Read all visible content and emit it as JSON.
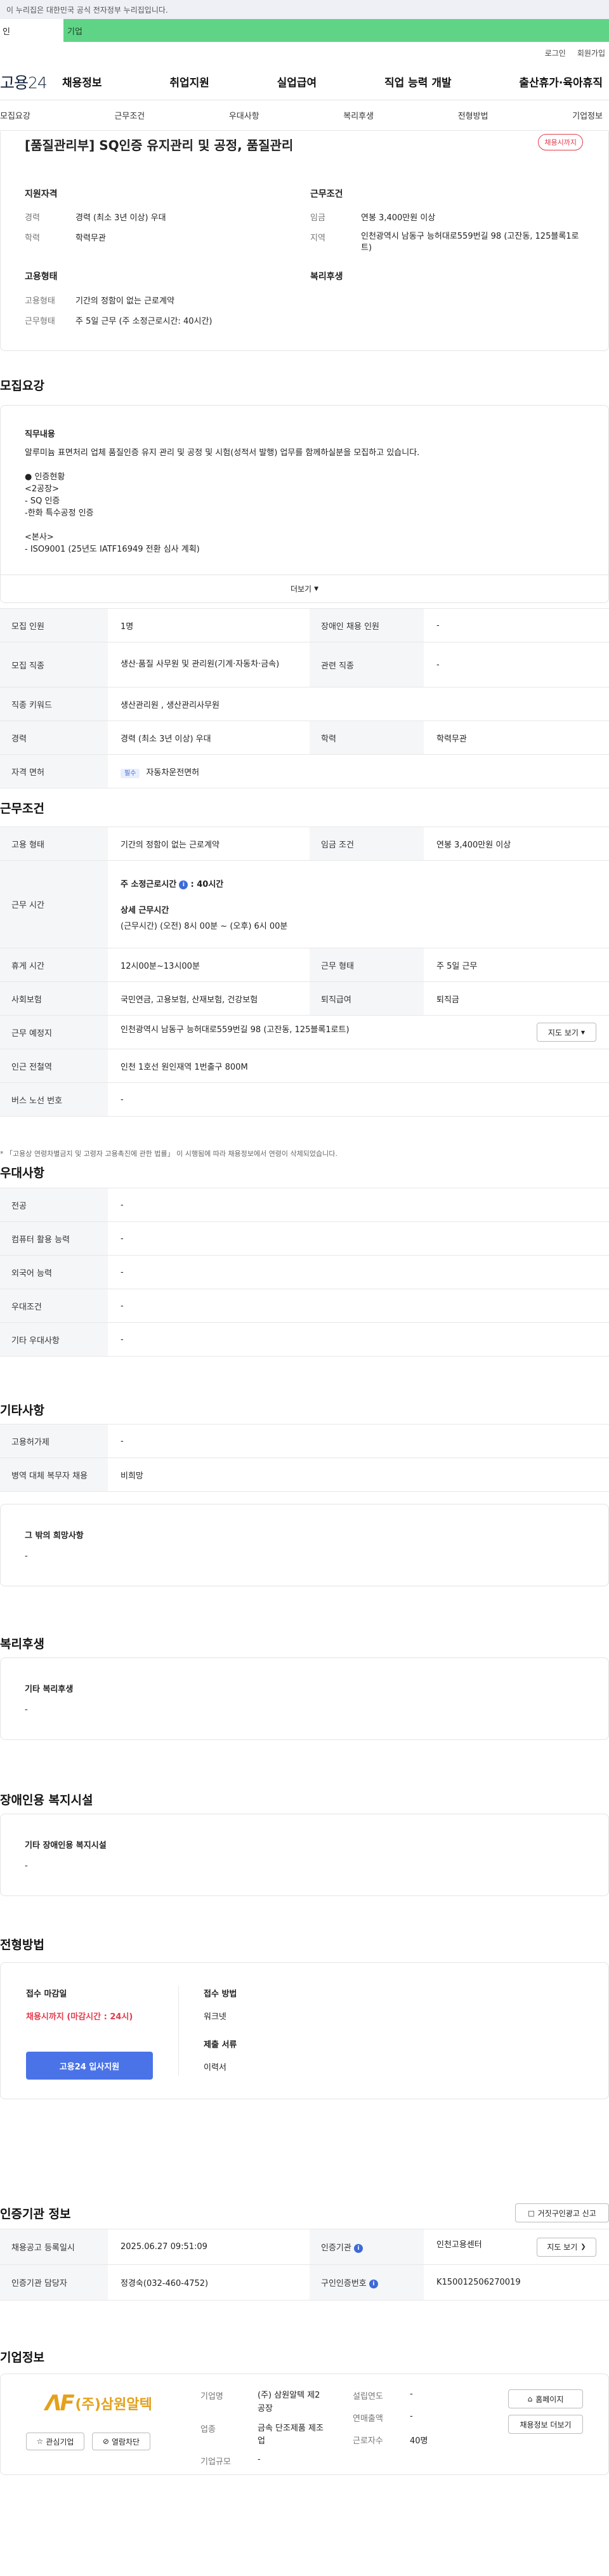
{
  "gov_bar": "이 누리집은 대한민국 공식 전자정부 누리집입니다.",
  "top_tabs": [
    "인",
    "기업"
  ],
  "util": [
    "로그인",
    "회원가입"
  ],
  "logo": "고용24",
  "gnb": [
    "채용정보",
    "취업지원",
    "실업급여",
    "직업 능력 개발",
    "출산휴가·육아휴직"
  ],
  "tabs": [
    "모집요강",
    "근무조건",
    "우대사항",
    "복리후생",
    "전형방법",
    "기업정보"
  ],
  "job": {
    "title": "[품질관리부] SQ인증 유지관리 및 공정, 품질관리",
    "badge": "채용시까지",
    "support_h": "지원자격",
    "cond_h": "근무조건",
    "employ_h": "고용형태",
    "welfare_h": "복리후생",
    "s1_l": "경력",
    "s1_v": "경력 (최소 3년 이상) 우대",
    "s2_l": "학력",
    "s2_v": "학력무관",
    "c1_l": "임금",
    "c1_v": "연봉 3,400만원 이상",
    "c2_l": "지역",
    "c2_v": "인천광역시 남동구 능허대로559번길 98 (고잔동, 125블록1로트)",
    "e1_l": "고용형태",
    "e1_v": "기간의 정함이 없는 근로계약",
    "e2_l": "근무형태",
    "e2_v": "주 5일 근무 (주 소정근로시간: 40시간)"
  },
  "recruit": {
    "title": "모집요강",
    "duty_h": "직무내용",
    "duty_lines": [
      "알루미늄 표면처리 업체 품질인증 유지 관리 및 공정 및 시험(성적서 발행) 업무를 함께하실분을 모집하고 있습니다.",
      "",
      "● 인증현황",
      "<2공장>",
      "- SQ 인증",
      "-한화 특수공정 인증",
      "",
      "<본사>",
      "- ISO9001 (25년도 IATF16949 전환 심사 계획)"
    ],
    "more": "더보기",
    "rows": [
      {
        "l1": "모집 인원",
        "v1": "1명",
        "l2": "장애인 채용 인원",
        "v2": "-"
      },
      {
        "l1": "모집 직종",
        "v1": "생산·품질 사무원 및 관리원(기계·자동차·금속)",
        "l2": "관련 직종",
        "v2": "-"
      },
      {
        "l1": "직종 키워드",
        "v1": "생산관리원 , 생산관리사무원"
      },
      {
        "l1": "경력",
        "v1": "경력 (최소 3년 이상) 우대",
        "l2": "학력",
        "v2": "학력무관"
      },
      {
        "l1": "자격 면허",
        "tag": "필수",
        "v1": "자동차운전면허"
      }
    ]
  },
  "work": {
    "title": "근무조건",
    "r1_l": "고용 형태",
    "r1_v": "기간의 정함이 없는 근로계약",
    "r1_l2": "임금 조건",
    "r1_v2": "연봉 3,400만원 이상",
    "r2_l": "근무 시간",
    "r2_a": "주 소정근로시간",
    "r2_b": ": 40시간",
    "r2_c": "상세 근무시간",
    "r2_d": "(근무시간) (오전) 8시 00분 ~ (오후) 6시 00분",
    "r3_l": "휴게 시간",
    "r3_v": "12시00분~13시00분",
    "r3_l2": "근무 형태",
    "r3_v2": "주 5일 근무",
    "r4_l": "사회보험",
    "r4_v": "국민연금, 고용보험, 산재보험, 건강보험",
    "r4_l2": "퇴직급여",
    "r4_v2": "퇴직금",
    "r5_l": "근무 예정지",
    "r5_v": "인천광역시 남동구 능허대로559번길 98 (고잔동, 125블록1로트)",
    "r5_btn": "지도 보기",
    "r6_l": "인근 전철역",
    "r6_v": "인천 1호선 원인재역 1번출구 800M",
    "r7_l": "버스 노선 번호",
    "r7_v": "-",
    "note": "* 「고용상 연령차별금지 및 고령자 고용촉진에 관한 법률」 이 시행됨에 따라 채용정보에서 연령이 삭제되었습니다."
  },
  "pref": {
    "title": "우대사항",
    "rows": [
      {
        "l": "전공",
        "v": "-"
      },
      {
        "l": "컴퓨터 활용 능력",
        "v": "-"
      },
      {
        "l": "외국어 능력",
        "v": "-"
      },
      {
        "l": "우대조건",
        "v": "-"
      },
      {
        "l": "기타 우대사항",
        "v": "-"
      }
    ]
  },
  "etc": {
    "title": "기타사항",
    "rows": [
      {
        "l": "고용허가제",
        "v": "-"
      },
      {
        "l": "병역 대체 복무자 채용",
        "v": "비희망"
      }
    ],
    "other_h": "그 밖의 희망사항",
    "other_v": "-"
  },
  "welfare": {
    "title": "복리후생",
    "h": "기타 복리후생",
    "v": "-"
  },
  "disab": {
    "title": "장애인용 복지시설",
    "h": "기타 장애인용 복지시설",
    "v": "-"
  },
  "proc": {
    "title": "전형방법",
    "deadline_h": "접수 마감일",
    "deadline_v": "채용시까지 (마감시간 : 24시)",
    "apply_btn": "고용24 입사지원",
    "method_h": "접수 방법",
    "method_v": "워크넷",
    "docs_h": "제출 서류",
    "docs_v": "이력서"
  },
  "agency": {
    "title": "인증기관 정보",
    "report_btn": "거짓구인광고 신고",
    "r1_l": "채용공고 등록일시",
    "r1_v": "2025.06.27 09:51:09",
    "r1_l2": "인증기관",
    "r1_v2": "인천고용센터",
    "r1_btn": "지도 보기",
    "r2_l": "인증기관 담당자",
    "r2_v": "정경숙(032-460-4752)",
    "r2_l2": "구인인증번호",
    "r2_v2": "K150012506270019"
  },
  "company": {
    "title": "기업정보",
    "logo_text": "(주)삼원알텍",
    "fav_btn": "관심기업",
    "block_btn": "열람차단",
    "name_l": "기업명",
    "name_v": "(주) 삼원알텍 제2공장",
    "ind_l": "업종",
    "ind_v": "금속 단조제품 제조업",
    "size_l": "기업규모",
    "size_v": "-",
    "year_l": "설립연도",
    "year_v": "-",
    "sales_l": "연매출액",
    "sales_v": "-",
    "emp_l": "근로자수",
    "emp_v": "40명",
    "home_btn": "홈페이지",
    "more_btn": "채용정보 더보기"
  },
  "colors": {
    "accent": "#4a73e8",
    "red": "#e23b4d",
    "green": "#5fd487"
  }
}
